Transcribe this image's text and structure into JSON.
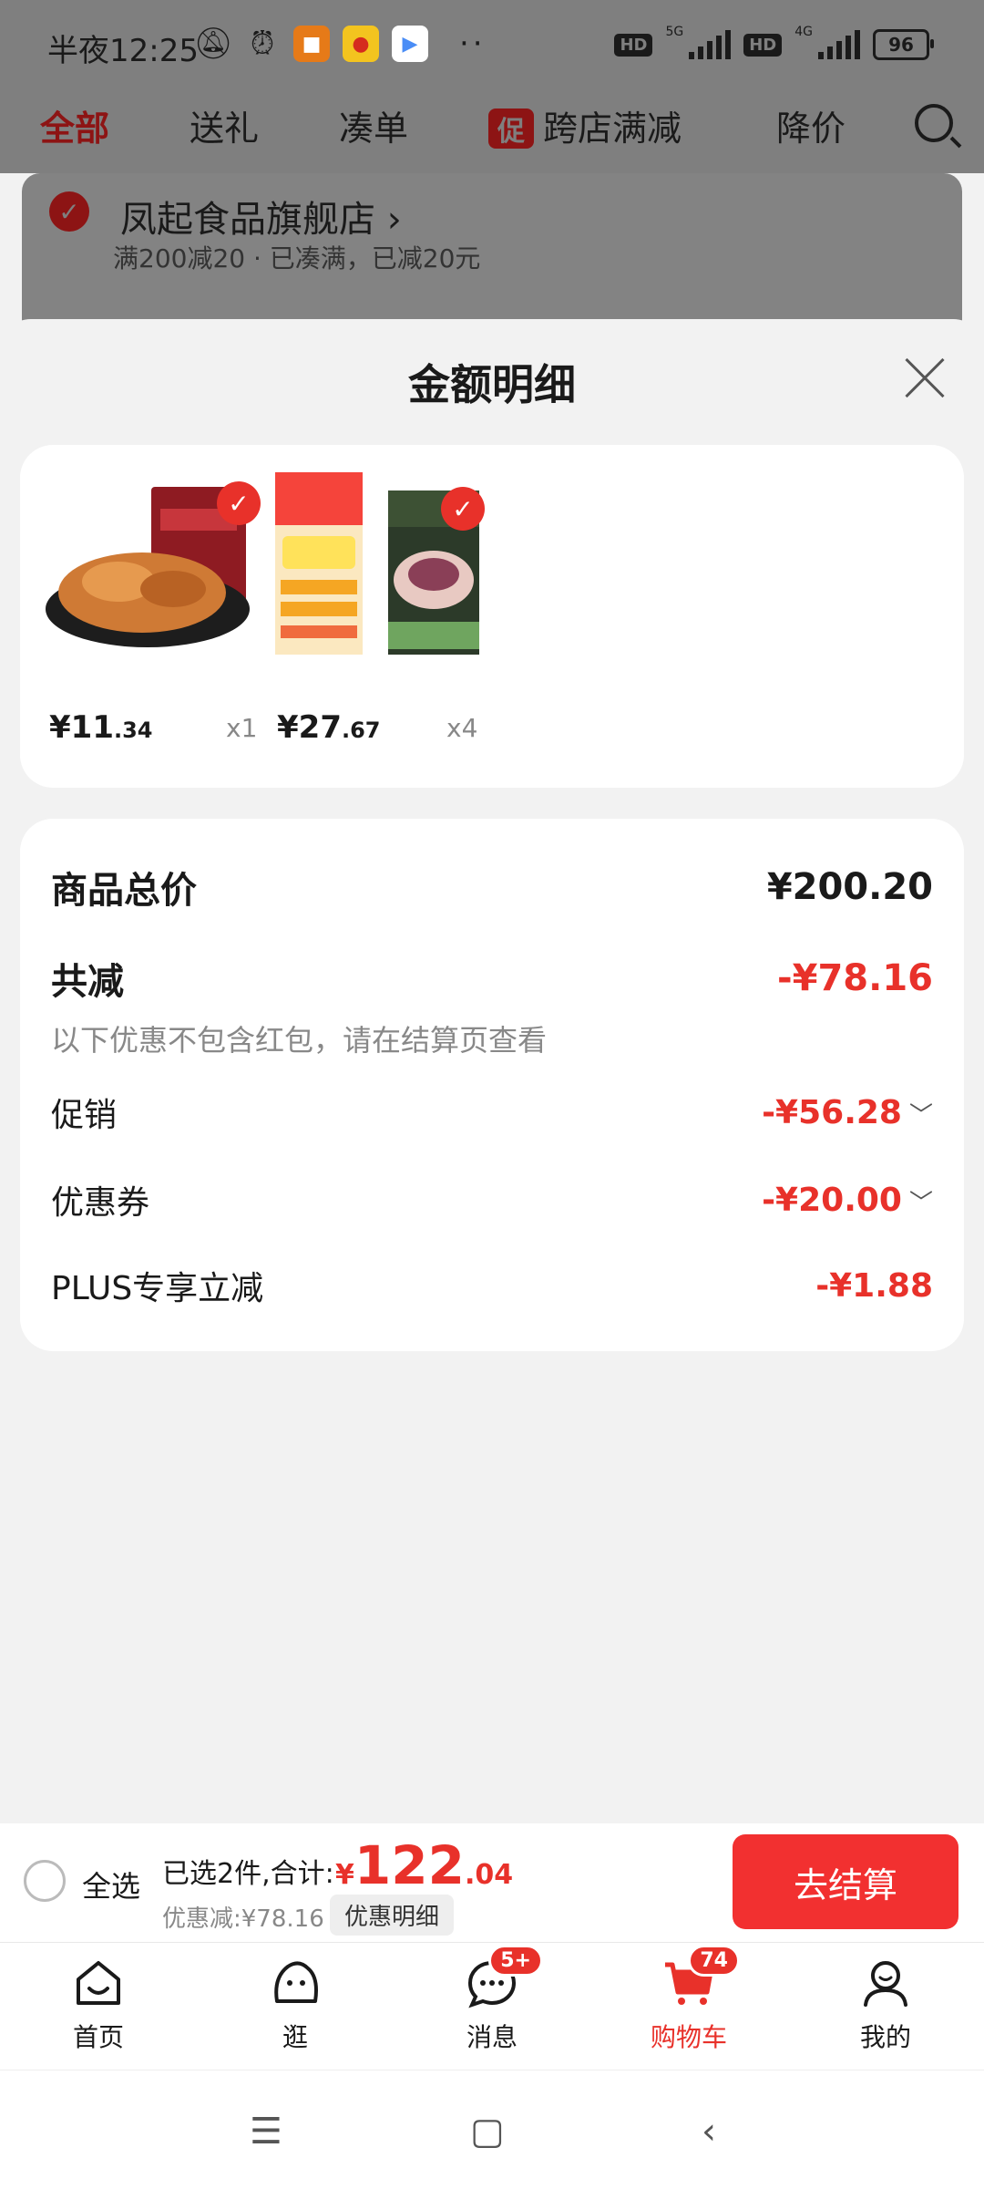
{
  "status_bar": {
    "time": "半夜12:25",
    "battery": "96",
    "net1": "5G",
    "net2": "4G",
    "hd": "HD"
  },
  "background": {
    "tabs": [
      "全部",
      "送礼",
      "凑单",
      "跨店满减",
      "降价"
    ],
    "promo_badge": "促",
    "store_name": "凤起食品旗舰店",
    "store_sub": "满200减20 · 已凑满，已减20元"
  },
  "sheet": {
    "title": "金额明细"
  },
  "products": [
    {
      "price_int": "¥11",
      "price_dec": ".34",
      "qty": "x1"
    },
    {
      "price_int": "¥27",
      "price_dec": ".67",
      "qty": "x4"
    }
  ],
  "summary": {
    "total_label": "商品总价",
    "total_value": "¥200.20",
    "reduce_label": "共减",
    "reduce_value": "-¥78.16",
    "note": "以下优惠不包含红包，请在结算页查看",
    "promo_label": "促销",
    "promo_value": "-¥56.28",
    "coupon_label": "优惠券",
    "coupon_value": "-¥20.00",
    "plus_label": "PLUS专享立减",
    "plus_value": "-¥1.88"
  },
  "checkout": {
    "select_all": "全选",
    "selected_info": "已选2件,合计:",
    "yen": "¥",
    "total_int": "122",
    "total_dec": ".04",
    "discount": "优惠减:¥78.16",
    "detail_chip": "优惠明细",
    "button": "去结算"
  },
  "tabbar": {
    "items": [
      {
        "label": "首页",
        "icon": "home-icon"
      },
      {
        "label": "逛",
        "icon": "browse-icon"
      },
      {
        "label": "消息",
        "icon": "message-icon",
        "badge": "5+"
      },
      {
        "label": "购物车",
        "icon": "cart-icon",
        "badge": "74"
      },
      {
        "label": "我的",
        "icon": "profile-icon"
      }
    ]
  },
  "colors": {
    "accent": "#e8312a",
    "button": "#f23030"
  }
}
